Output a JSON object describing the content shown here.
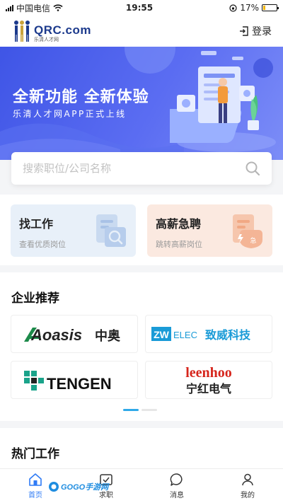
{
  "status_bar": {
    "carrier": "中国电信",
    "time": "19:55",
    "battery": "17%",
    "battery_level": 0.17
  },
  "header": {
    "logo_text": "QRC.com",
    "logo_subtext": "乐清人才网",
    "login_label": "登录"
  },
  "banner": {
    "title": "全新功能  全新体验",
    "subtitle": "乐清人才网APP正式上线"
  },
  "search": {
    "placeholder": "搜索职位/公司名称"
  },
  "quick_cards": [
    {
      "title": "找工作",
      "subtitle": "查看优质岗位"
    },
    {
      "title": "高薪急聘",
      "subtitle": "跳转高薪岗位"
    }
  ],
  "companies": {
    "title": "企业推荐",
    "logos": [
      {
        "word": "Aoasis",
        "cn": "中奥"
      },
      {
        "mark": "ZW",
        "word": "ELEC",
        "cn": "致威科技"
      },
      {
        "word": "TENGEN"
      },
      {
        "word": "leenhoo",
        "cn": "宁红电气"
      }
    ],
    "active_slide": 1,
    "slide_count": 2
  },
  "hot_jobs": {
    "title": "热门工作"
  },
  "tabs": [
    {
      "label": "首页",
      "icon": "home-icon"
    },
    {
      "label": "求职",
      "icon": "job-icon"
    },
    {
      "label": "消息",
      "icon": "message-icon"
    },
    {
      "label": "我的",
      "icon": "user-icon"
    }
  ],
  "watermark": {
    "text": "GOGO手游网"
  },
  "colors": {
    "primary": "#2f7bf5",
    "banner": "#4a5fec",
    "find_card": "#e8f0f9",
    "urgent_card": "#fbe9e0",
    "accent_orange": "#f29b6b"
  }
}
